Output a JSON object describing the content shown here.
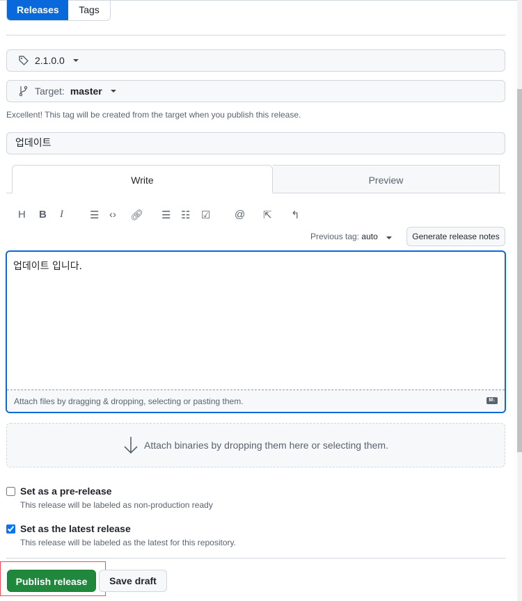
{
  "tabs": {
    "releases": "Releases",
    "tags": "Tags"
  },
  "tag_select": {
    "value": "2.1.0.0",
    "icon": "tag-icon"
  },
  "target_select": {
    "label": "Target:",
    "value": "master",
    "icon": "git-branch-icon"
  },
  "tag_note": "Excellent! This tag will be created from the target when you publish this release.",
  "release_title": "업데이트",
  "editor_tabs": {
    "write": "Write",
    "preview": "Preview"
  },
  "toolbar": {
    "heading": "H",
    "bold": "B",
    "italic": "I"
  },
  "previous_tag": {
    "label": "Previous tag:",
    "value": "auto"
  },
  "generate_notes": "Generate release notes",
  "body_text": "업데이트 입니다.",
  "attach_files": "Attach files by dragging & dropping, selecting or pasting them.",
  "markdown_badge": "M↓",
  "attach_binaries": "Attach binaries by dropping them here or selecting them.",
  "prerelease": {
    "label": "Set as a pre-release",
    "note": "This release will be labeled as non-production ready",
    "checked": false
  },
  "latest": {
    "label": "Set as the latest release",
    "note": "This release will be labeled as the latest for this repository.",
    "checked": true
  },
  "buttons": {
    "publish": "Publish release",
    "draft": "Save draft"
  },
  "colors": {
    "accent": "#0969da",
    "publish": "#1f883d",
    "highlight": "#e8505b"
  }
}
